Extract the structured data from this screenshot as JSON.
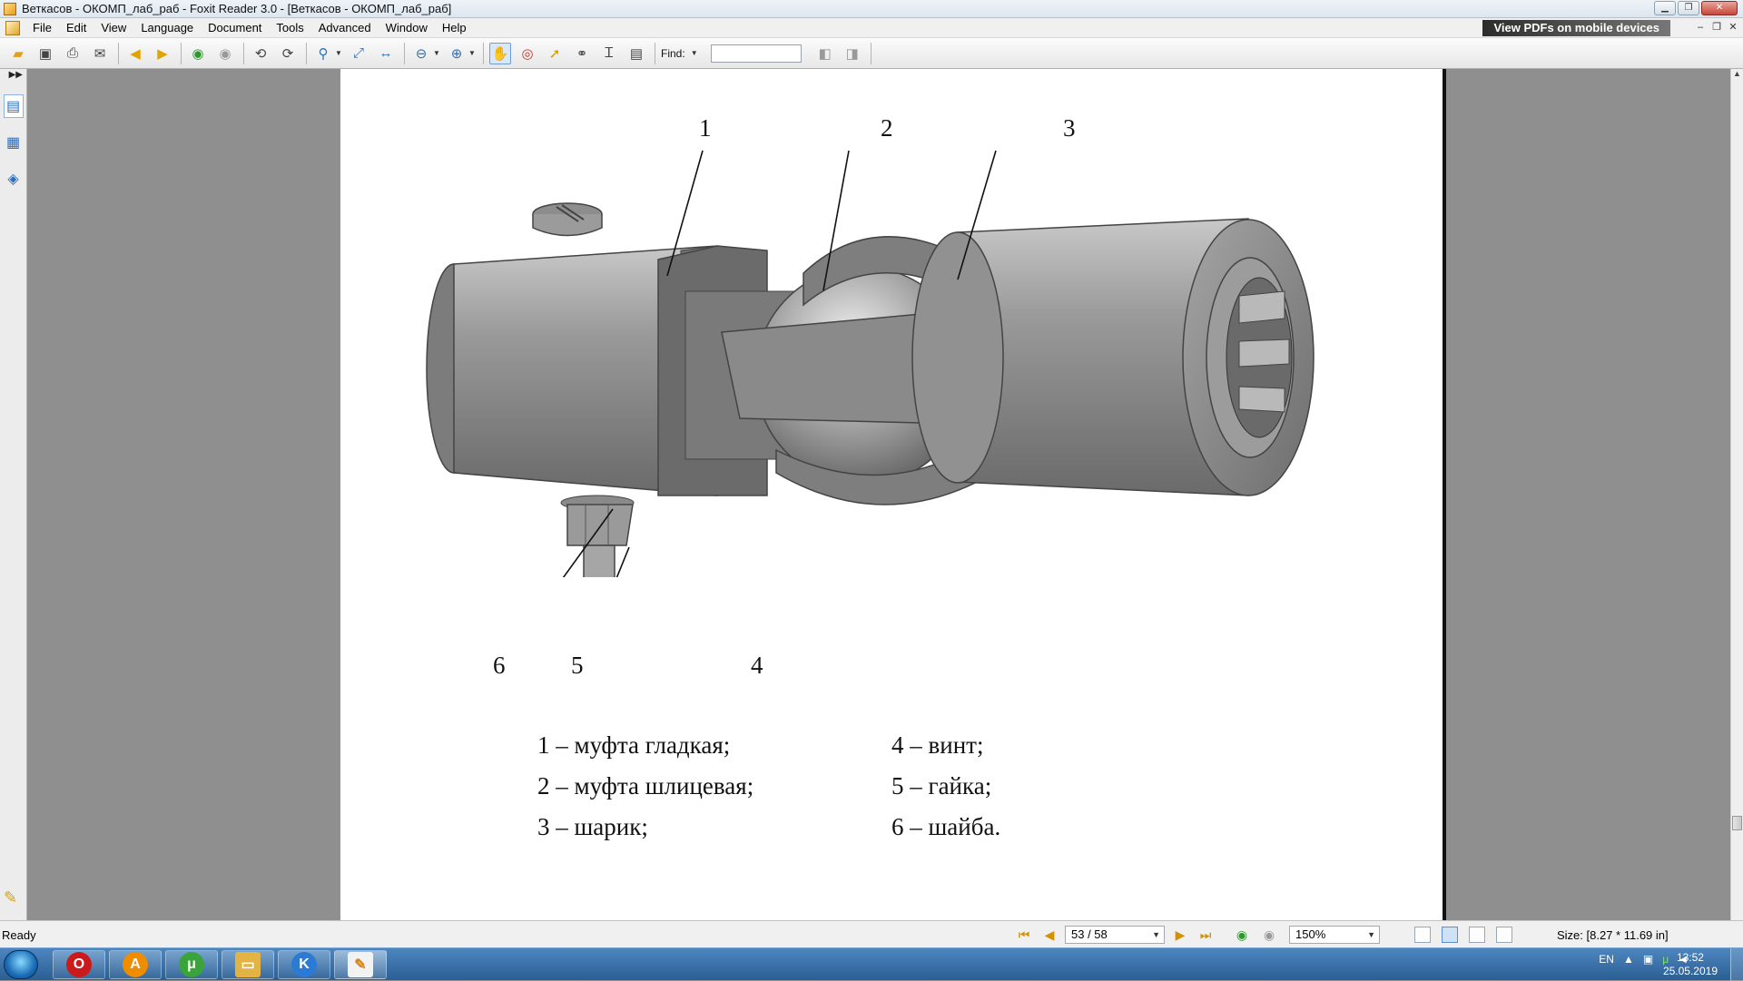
{
  "window": {
    "title": "Веткасов - ОКОМП_лаб_раб - Foxit Reader 3.0 - [Веткасов - ОКОМП_лаб_раб]"
  },
  "menu": {
    "items": [
      "File",
      "Edit",
      "View",
      "Language",
      "Document",
      "Tools",
      "Advanced",
      "Window",
      "Help"
    ],
    "promo": "View PDFs on mobile devices"
  },
  "toolbar": {
    "find_label": "Find:",
    "find_value": ""
  },
  "figure": {
    "callouts": [
      "1",
      "2",
      "3",
      "6",
      "5",
      "4"
    ],
    "legend": [
      "1 – муфта гладкая;",
      "2 – муфта шлицевая;",
      "3 – шарик;",
      "4 – винт;",
      "5 – гайка;",
      "6 – шайба."
    ],
    "body_color": "#8c8c8c"
  },
  "status": {
    "ready": "Ready",
    "page": "53 / 58",
    "zoom": "150%",
    "size": "Size: [8.27 * 11.69 in]"
  },
  "taskbar": {
    "apps": [
      "opera-icon",
      "avast-icon",
      "utorrent-icon",
      "file-explorer-icon",
      "k-app-icon",
      "foxit-reader-icon"
    ],
    "lang": "EN",
    "time": "13:52",
    "date": "25.05.2019"
  }
}
